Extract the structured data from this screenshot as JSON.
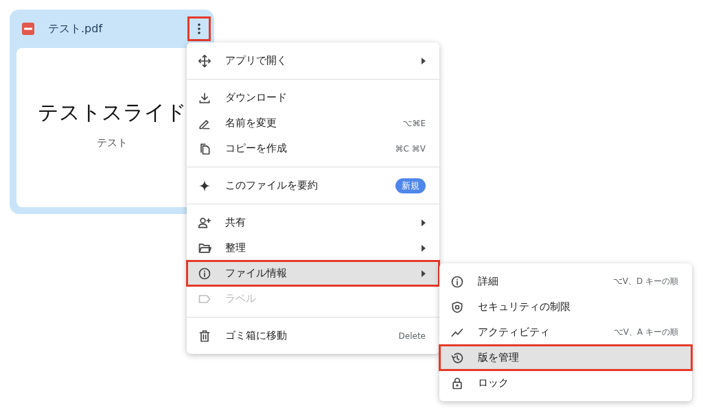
{
  "file_card": {
    "title": "テスト.pdf",
    "menu_button_highlighted": true,
    "preview": {
      "heading": "テストスライド",
      "subtitle": "テスト"
    }
  },
  "context_menu": {
    "sections": [
      {
        "items": [
          {
            "label": "アプリで開く",
            "submenu": true,
            "disabled": false,
            "highlighted": false
          }
        ]
      },
      {
        "items": [
          {
            "label": "ダウンロード",
            "submenu": false,
            "disabled": false,
            "highlighted": false
          },
          {
            "label": "名前を変更",
            "shortcut": "⌥⌘E",
            "submenu": false,
            "disabled": false,
            "highlighted": false
          },
          {
            "label": "コピーを作成",
            "shortcut": "⌘C ⌘V",
            "submenu": false,
            "disabled": false,
            "highlighted": false
          }
        ]
      },
      {
        "items": [
          {
            "label": "このファイルを要約",
            "badge": "新規",
            "submenu": false,
            "disabled": false,
            "highlighted": false
          }
        ]
      },
      {
        "items": [
          {
            "label": "共有",
            "submenu": true,
            "disabled": false,
            "highlighted": false
          },
          {
            "label": "整理",
            "submenu": true,
            "disabled": false,
            "highlighted": false
          },
          {
            "label": "ファイル情報",
            "submenu": true,
            "disabled": false,
            "highlighted": true
          },
          {
            "label": "ラベル",
            "submenu": false,
            "disabled": true,
            "highlighted": false
          }
        ]
      },
      {
        "items": [
          {
            "label": "ゴミ箱に移動",
            "shortcut": "Delete",
            "submenu": false,
            "disabled": false,
            "highlighted": false
          }
        ]
      }
    ]
  },
  "submenu": {
    "items": [
      {
        "label": "詳細",
        "shortcut": "⌥V、D キーの順",
        "highlighted": false
      },
      {
        "label": "セキュリティの制限",
        "highlighted": false
      },
      {
        "label": "アクティビティ",
        "shortcut": "⌥V、A キーの順",
        "highlighted": false
      },
      {
        "label": "版を管理",
        "highlighted": true
      },
      {
        "label": "ロック",
        "highlighted": false
      }
    ]
  }
}
